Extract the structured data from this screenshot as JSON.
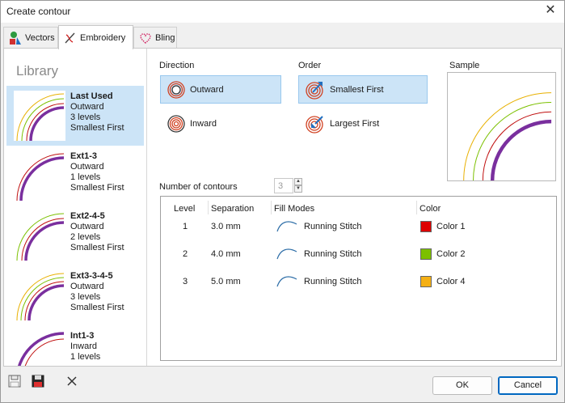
{
  "window": {
    "title": "Create contour"
  },
  "tabs": [
    {
      "label": "Vectors"
    },
    {
      "label": "Embroidery"
    },
    {
      "label": "Bling"
    }
  ],
  "library": {
    "title": "Library",
    "items": [
      {
        "name": "Last Used",
        "direction": "Outward",
        "levels": "3 levels",
        "order": "Smallest First"
      },
      {
        "name": "Ext1-3",
        "direction": "Outward",
        "levels": "1 levels",
        "order": "Smallest First"
      },
      {
        "name": "Ext2-4-5",
        "direction": "Outward",
        "levels": "2 levels",
        "order": "Smallest First"
      },
      {
        "name": "Ext3-3-4-5",
        "direction": "Outward",
        "levels": "3 levels",
        "order": "Smallest First"
      },
      {
        "name": "Int1-3",
        "direction": "Inward",
        "levels": "1 levels",
        "order": ""
      }
    ]
  },
  "direction": {
    "label": "Direction",
    "outward": "Outward",
    "inward": "Inward",
    "selected": "Outward"
  },
  "order": {
    "label": "Order",
    "smallest": "Smallest First",
    "largest": "Largest First",
    "selected": "Smallest First"
  },
  "sample": {
    "label": "Sample"
  },
  "contours": {
    "label": "Number of contours",
    "value": "3"
  },
  "table": {
    "headers": {
      "level": "Level",
      "separation": "Separation",
      "fill": "Fill Modes",
      "color": "Color"
    },
    "rows": [
      {
        "level": "1",
        "separation": "3.0 mm",
        "fill": "Running Stitch",
        "color": "Color 1",
        "hex": "#dd0000"
      },
      {
        "level": "2",
        "separation": "4.0 mm",
        "fill": "Running Stitch",
        "color": "Color 2",
        "hex": "#7cc000"
      },
      {
        "level": "3",
        "separation": "5.0 mm",
        "fill": "Running Stitch",
        "color": "Color 4",
        "hex": "#f5b014"
      }
    ]
  },
  "buttons": {
    "ok": "OK",
    "cancel": "Cancel"
  },
  "colors": {
    "accent": "#0067c0",
    "selection": "#cce4f7",
    "purple": "#7a2f9e"
  }
}
